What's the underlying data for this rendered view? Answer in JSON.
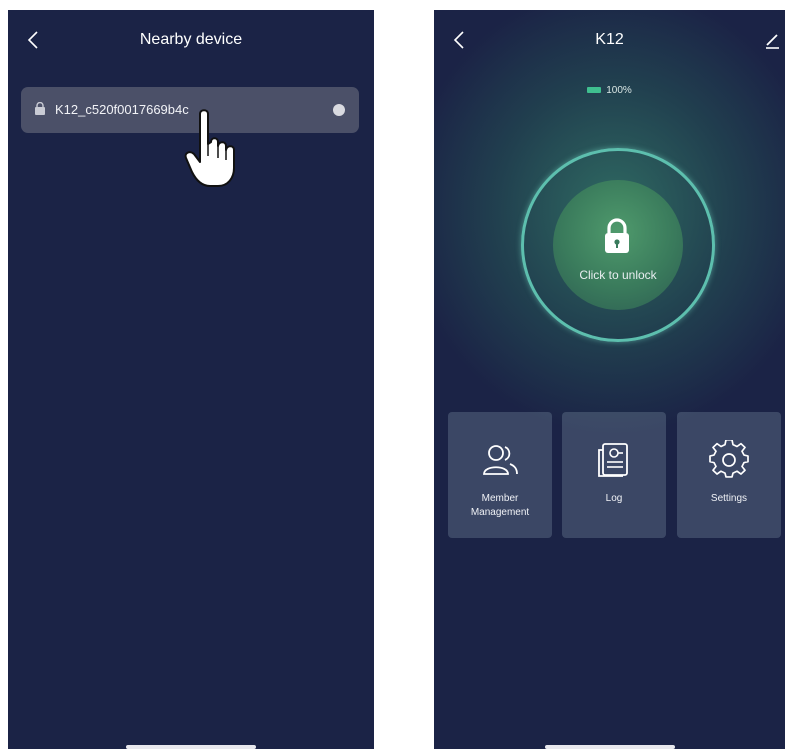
{
  "left_screen": {
    "title": "Nearby device",
    "device_name": "K12_c520f0017669b4c"
  },
  "right_screen": {
    "title": "K12",
    "battery_percent": "100%",
    "unlock_label": "Click to unlock",
    "tiles": [
      {
        "label": "Member Management",
        "icon": "member-icon"
      },
      {
        "label": "Log",
        "icon": "log-icon"
      },
      {
        "label": "Settings",
        "icon": "gear-icon"
      }
    ]
  },
  "colors": {
    "background": "#1b2346",
    "accent": "#5dbfae",
    "battery": "#3fbf8f"
  }
}
